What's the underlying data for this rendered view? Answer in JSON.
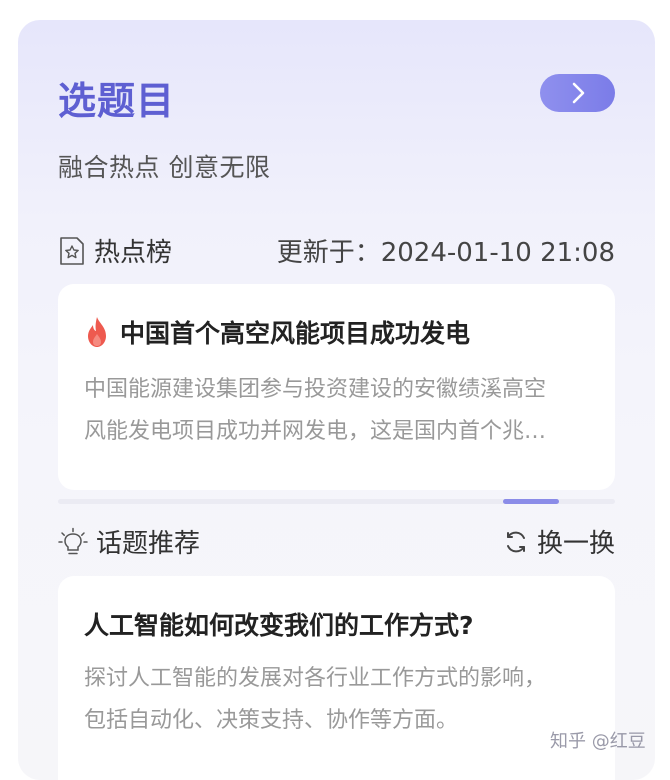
{
  "header": {
    "title": "选题目",
    "subtitle": "融合热点 创意无限"
  },
  "hot": {
    "label": "热点榜",
    "updated": "更新于：2024-01-10 21:08",
    "item_title": "中国首个高空风能项目成功发电",
    "item_desc_line1": "中国能源建设集团参与投资建设的安徽绩溪高空",
    "item_desc_line2": "风能发电项目成功并网发电，这是国内首个兆…",
    "progress_fraction": 0.2
  },
  "topics": {
    "label": "话题推荐",
    "refresh_label": "换一换",
    "item_title": "人工智能如何改变我们的工作方式?",
    "item_desc_line1": "探讨人工智能的发展对各行业工作方式的影响，",
    "item_desc_line2": "包括自动化、决策支持、协作等方面。"
  },
  "watermark": "知乎 @红豆",
  "colors": {
    "accent": "#5e5fd2",
    "button": "#8b8ce8",
    "flame": "#ee5a4f"
  }
}
